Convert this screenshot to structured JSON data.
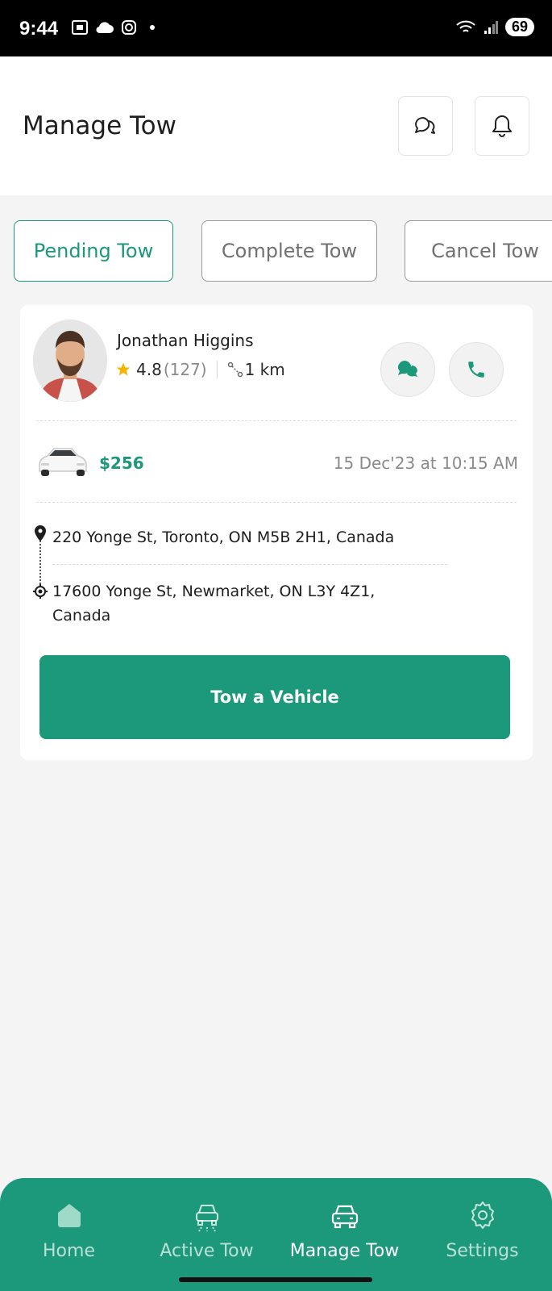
{
  "status_bar": {
    "time": "9:44",
    "battery": "69"
  },
  "header": {
    "title": "Manage Tow"
  },
  "tabs": [
    {
      "label": "Pending Tow",
      "active": true
    },
    {
      "label": "Complete Tow",
      "active": false
    },
    {
      "label": "Cancel Tow",
      "active": false
    }
  ],
  "request": {
    "name": "Jonathan Higgins",
    "rating": "4.8",
    "rating_count": "(127)",
    "distance": "1 km",
    "price": "$256",
    "datetime": "15 Dec'23 at 10:15 AM",
    "pickup": "220 Yonge St, Toronto, ON M5B 2H1, Canada",
    "dropoff_line1": "17600 Yonge St, Newmarket, ON L3Y 4Z1,",
    "dropoff_line2": "Canada",
    "action_label": "Tow a Vehicle"
  },
  "nav": [
    {
      "label": "Home",
      "icon": "home-icon"
    },
    {
      "label": "Active Tow",
      "icon": "tow-truck-icon"
    },
    {
      "label": "Manage Tow",
      "icon": "car-icon"
    },
    {
      "label": "Settings",
      "icon": "gear-icon"
    }
  ],
  "colors": {
    "accent": "#1c987a",
    "background": "#f4f4f4",
    "star": "#f5b400"
  }
}
